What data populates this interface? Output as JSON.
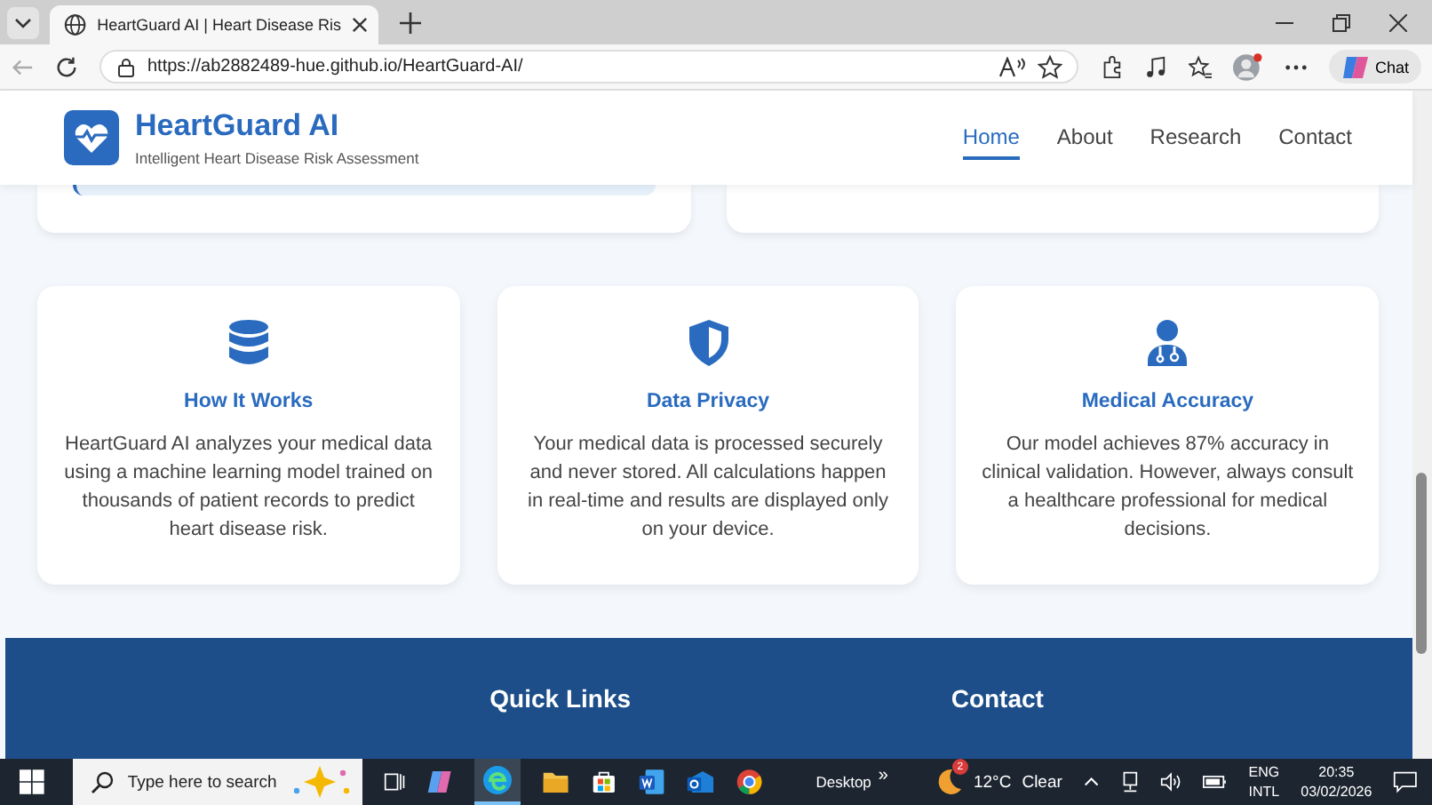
{
  "browser": {
    "tab_title": "HeartGuard AI | Heart Disease Ris",
    "url": "https://ab2882489-hue.github.io/HeartGuard-AI/",
    "chat_label": "Chat"
  },
  "header": {
    "brand": "HeartGuard AI",
    "tagline": "Intelligent Heart Disease Risk Assessment",
    "nav": [
      {
        "label": "Home",
        "selected": true
      },
      {
        "label": "About",
        "selected": false
      },
      {
        "label": "Research",
        "selected": false
      },
      {
        "label": "Contact",
        "selected": false
      }
    ]
  },
  "features": [
    {
      "kind": "database",
      "title": "How It Works",
      "text": "HeartGuard AI analyzes your medical data using a machine learning model trained on thousands of patient records to predict heart disease risk."
    },
    {
      "kind": "shield",
      "title": "Data Privacy",
      "text": "Your medical data is processed securely and never stored. All calculations happen in real-time and results are displayed only on your device."
    },
    {
      "kind": "doctor",
      "title": "Medical Accuracy",
      "text": "Our model achieves 87% accuracy in clinical validation. However, always consult a healthcare professional for medical decisions."
    }
  ],
  "footer": {
    "headings": [
      "Quick Links",
      "Contact"
    ]
  },
  "taskbar": {
    "search_placeholder": "Type here to search",
    "desktop_label": "Desktop",
    "overflow": "»",
    "weather": {
      "badge": "2",
      "temperature": "12°C",
      "condition": "Clear"
    },
    "language": [
      "ENG",
      "INTL"
    ],
    "time": "20:35",
    "date": "03/02/2026"
  }
}
